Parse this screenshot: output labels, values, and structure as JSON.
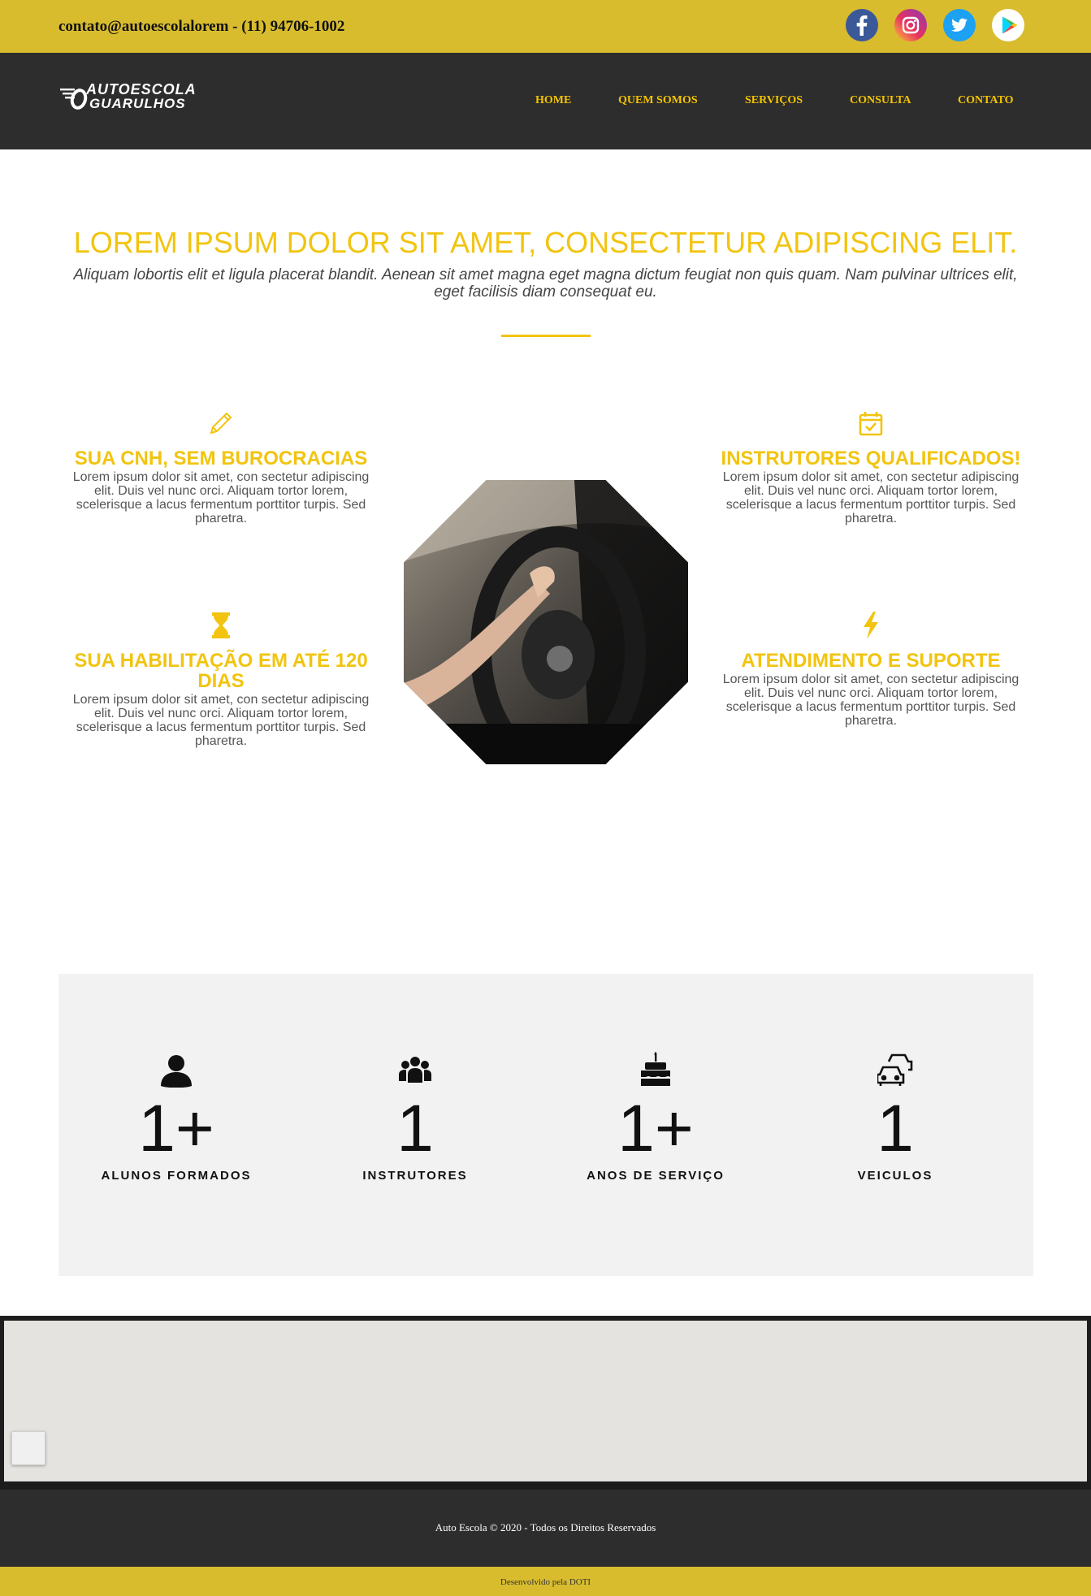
{
  "topbar": {
    "contact": "contato@autoescolalorem - (11) 94706-1002",
    "social": [
      {
        "icon": "facebook-icon",
        "color": "#3b5998"
      },
      {
        "icon": "instagram-icon",
        "color": "#d6249f"
      },
      {
        "icon": "twitter-icon",
        "color": "#1da1f2"
      },
      {
        "icon": "google-play-icon",
        "color": "#ffffff"
      }
    ]
  },
  "nav": {
    "logo_line1": "AUTOESCOLA",
    "logo_line2": "GUARULHOS",
    "items": [
      "HOME",
      "QUEM SOMOS",
      "SERVIÇOS",
      "CONSULTA",
      "CONTATO"
    ]
  },
  "hero": {
    "title": "LOREM IPSUM DOLOR SIT AMET, CONSECTETUR ADIPISCING ELIT.",
    "subtitle": "Aliquam lobortis elit et ligula placerat blandit. Aenean sit amet magna eget magna dictum feugiat non quis quam. Nam pulvinar ultrices elit, eget facilisis diam consequat eu."
  },
  "features": [
    {
      "icon": "pencil-icon",
      "title": "SUA CNH, SEM BUROCRACIAS",
      "text": "Lorem ipsum dolor sit amet, con sectetur adipiscing elit. Duis vel nunc orci. Aliquam tortor lorem, scelerisque a lacus fermentum porttitor turpis. Sed pharetra."
    },
    {
      "icon": "calendar-check-icon",
      "title": "INSTRUTORES QUALIFICADOS!",
      "text": "Lorem ipsum dolor sit amet, con sectetur adipiscing elit. Duis vel nunc orci. Aliquam tortor lorem, scelerisque a lacus fermentum porttitor turpis. Sed pharetra."
    },
    {
      "icon": "hourglass-icon",
      "title": "SUA HABILITAÇÃO EM ATÉ 120 DIAS",
      "text": "Lorem ipsum dolor sit amet, con sectetur adipiscing elit. Duis vel nunc orci. Aliquam tortor lorem, scelerisque a lacus fermentum porttitor turpis. Sed pharetra."
    },
    {
      "icon": "lightning-icon",
      "title": "ATENDIMENTO E SUPORTE",
      "text": "Lorem ipsum dolor sit amet, con sectetur adipiscing elit. Duis vel nunc orci. Aliquam tortor lorem, scelerisque a lacus fermentum porttitor turpis. Sed pharetra."
    }
  ],
  "stats": [
    {
      "icon": "user-icon",
      "number": "1+",
      "label": "ALUNOS FORMADOS"
    },
    {
      "icon": "users-group-icon",
      "number": "1",
      "label": "INSTRUTORES"
    },
    {
      "icon": "birthday-cake-icon",
      "number": "1+",
      "label": "ANOS DE SERVIÇO"
    },
    {
      "icon": "cars-icon",
      "number": "1",
      "label": "VEICULOS"
    }
  ],
  "footer": {
    "copyright": "Auto Escola © 2020 - Todos os Direitos Reservados",
    "developer": "Desenvolvido pela DOTI"
  },
  "colors": {
    "accent": "#f2c40f",
    "topbar": "#d8bc2e",
    "dark": "#2d2d2d"
  }
}
